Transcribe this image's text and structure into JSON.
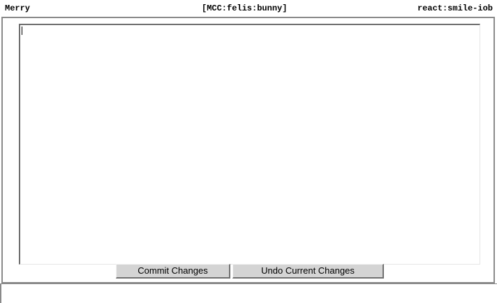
{
  "header": {
    "left_text": "Merry",
    "center_text": "[MCC:felis:bunny]",
    "right_text": "react:smile-iob"
  },
  "editor": {
    "value": "",
    "placeholder": ""
  },
  "buttons": {
    "commit_label": "Commit Changes",
    "undo_label": "Undo Current Changes"
  }
}
